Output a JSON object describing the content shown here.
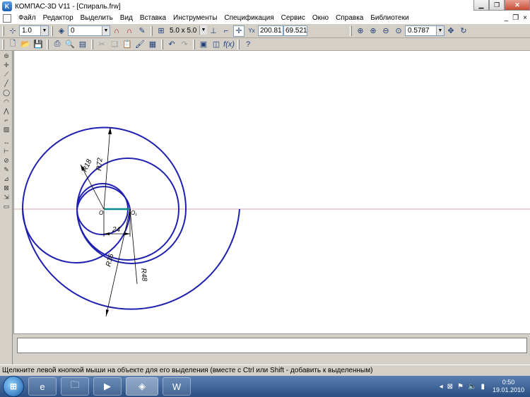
{
  "window": {
    "title": "КОМПАС-3D V11 - [Спираль.frw]",
    "icon": "kompas-logo-icon"
  },
  "menu": [
    {
      "label": "Файл"
    },
    {
      "label": "Редактор"
    },
    {
      "label": "Выделить"
    },
    {
      "label": "Вид"
    },
    {
      "label": "Вставка"
    },
    {
      "label": "Инструменты"
    },
    {
      "label": "Спецификация"
    },
    {
      "label": "Сервис"
    },
    {
      "label": "Окно"
    },
    {
      "label": "Справка"
    },
    {
      "label": "Библиотеки"
    }
  ],
  "toolbar1": {
    "line_scale": "1.0",
    "layer": "0",
    "grid_step": "5.0 x 5.0",
    "coord_x": "200.81",
    "coord_y": "69.521",
    "zoom": "0.5787"
  },
  "drawing": {
    "dim_labels": [
      "R18",
      "R72",
      "R36",
      "R48",
      "24"
    ],
    "center_label_1": "O",
    "center_label_2": "O₁"
  },
  "status": {
    "message": "Щелкните левой кнопкой мыши на объекте для его выделения (вместе с Ctrl или Shift - добавить к выделенным)"
  },
  "taskbar": {
    "time": "0:50",
    "date": "19.01.2010"
  }
}
